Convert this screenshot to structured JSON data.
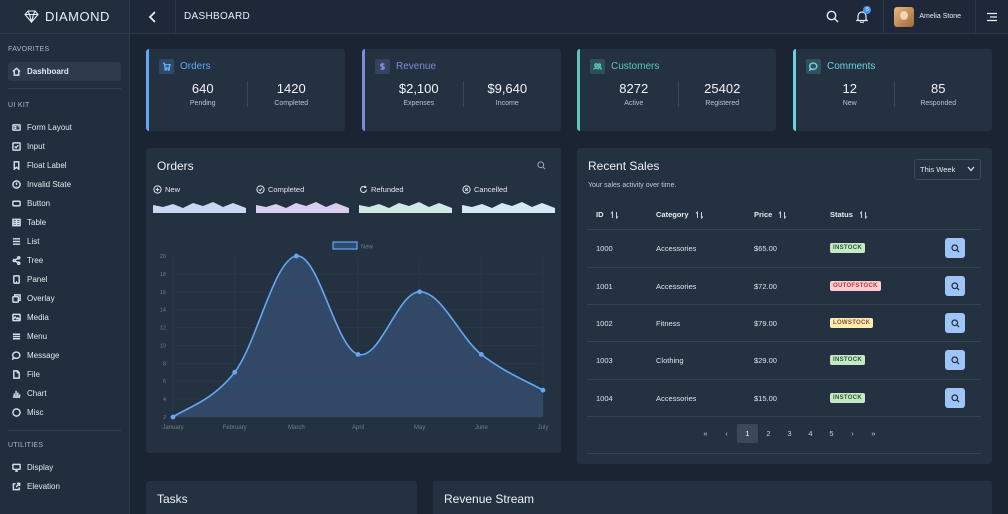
{
  "app": {
    "brand": "DIAMOND",
    "page_title": "DASHBOARD",
    "user_name": "Amelia Stone",
    "notification_count": "5"
  },
  "sidebar": {
    "favorites_title": "FAVORITES",
    "dashboard": "Dashboard",
    "uikit_title": "UI KIT",
    "uikit": [
      "Form Layout",
      "Input",
      "Float Label",
      "Invalid State",
      "Button",
      "Table",
      "List",
      "Tree",
      "Panel",
      "Overlay",
      "Media",
      "Menu",
      "Message",
      "File",
      "Chart",
      "Misc"
    ],
    "utilities_title": "UTILITIES",
    "utilities": [
      "Display",
      "Elevation"
    ]
  },
  "stats": [
    {
      "title": "Orders",
      "color": "#64a7f3",
      "icon": "cart-icon",
      "a_num": "640",
      "a_lbl": "Pending",
      "b_num": "1420",
      "b_lbl": "Completed"
    },
    {
      "title": "Revenue",
      "color": "#7f8bd8",
      "icon": "dollar-icon",
      "a_num": "$2,100",
      "a_lbl": "Expenses",
      "b_num": "$9,640",
      "b_lbl": "Income"
    },
    {
      "title": "Customers",
      "color": "#5bc7b8",
      "icon": "users-icon",
      "a_num": "8272",
      "a_lbl": "Active",
      "b_num": "25402",
      "b_lbl": "Registered"
    },
    {
      "title": "Comments",
      "color": "#6bd3df",
      "icon": "comment-icon",
      "a_num": "12",
      "a_lbl": "New",
      "b_num": "85",
      "b_lbl": "Responded"
    }
  ],
  "orders": {
    "title": "Orders",
    "tabs": [
      {
        "label": "New",
        "icon": "plus-circle-icon",
        "color": "#c8d8f0"
      },
      {
        "label": "Completed",
        "icon": "check-circle-icon",
        "color": "#d9cdf0"
      },
      {
        "label": "Refunded",
        "icon": "refresh-icon",
        "color": "#cfe9e4"
      },
      {
        "label": "Cancelled",
        "icon": "times-circle-icon",
        "color": "#d3eaf4"
      }
    ]
  },
  "chart_data": {
    "type": "area",
    "title": "",
    "legend": [
      "New"
    ],
    "categories": [
      "January",
      "February",
      "March",
      "April",
      "May",
      "June",
      "July"
    ],
    "series": [
      {
        "name": "New",
        "values": [
          2,
          7,
          20,
          9,
          16,
          9,
          5
        ]
      }
    ],
    "ylim": [
      2,
      20
    ],
    "yticks": [
      "2",
      "4",
      "6",
      "8",
      "10",
      "12",
      "14",
      "16",
      "18",
      "20"
    ],
    "grid": true,
    "line_color": "#64a7f3"
  },
  "sales": {
    "title": "Recent Sales",
    "subtitle": "Your sales activity over time.",
    "period": "This Week",
    "headers": [
      "ID",
      "Category",
      "Price",
      "Status"
    ],
    "rows": [
      {
        "id": "1000",
        "category": "Accessories",
        "price": "$65.00",
        "status": "INSTOCK"
      },
      {
        "id": "1001",
        "category": "Accessories",
        "price": "$72.00",
        "status": "OUTOFSTOCK"
      },
      {
        "id": "1002",
        "category": "Fitness",
        "price": "$79.00",
        "status": "LOWSTOCK"
      },
      {
        "id": "1003",
        "category": "Clothing",
        "price": "$29.00",
        "status": "INSTOCK"
      },
      {
        "id": "1004",
        "category": "Accessories",
        "price": "$15.00",
        "status": "INSTOCK"
      }
    ],
    "pager": {
      "first": "«",
      "prev": "‹",
      "pages": [
        "1",
        "2",
        "3",
        "4",
        "5"
      ],
      "current": "1",
      "next": "›",
      "last": "»"
    }
  },
  "tasks": {
    "title": "Tasks"
  },
  "revenue_stream": {
    "title": "Revenue Stream"
  }
}
